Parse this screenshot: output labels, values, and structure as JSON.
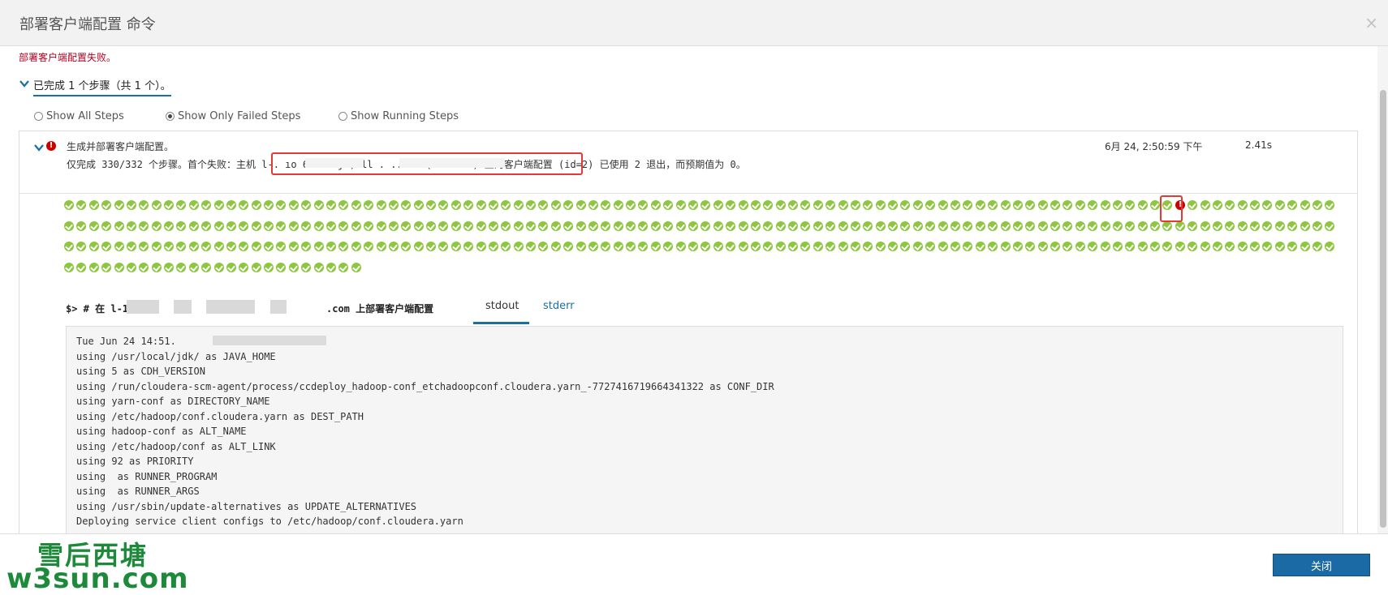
{
  "header": {
    "title": "部署客户端配置 命令",
    "close_glyph": "×"
  },
  "status": {
    "failure_message": "部署客户端配置失败。"
  },
  "summary": {
    "label": "已完成 1 个步骤（共 1 个）。"
  },
  "filters": [
    {
      "label": "Show All Steps",
      "checked": false
    },
    {
      "label": "Show Only Failed Steps",
      "checked": true
    },
    {
      "label": "Show Running Steps",
      "checked": false
    }
  ],
  "step": {
    "title": "生成并部署客户端配置。",
    "timestamp": "6月 24, 2:50:59 下午",
    "duration": "2.41s",
    "detail": "仅完成 330/332 个步骤。首个失败：主机 l-.          ıo 6d5    ı  j  , ll     .    ..com (id=8335) 上的客户端配置 (id=2) 已使用 2 退出，而预期值为 0。"
  },
  "command": {
    "prefix": "$> # 在 l-1",
    "suffix": ".com 上部署客户端配置",
    "tabs": [
      "stdout",
      "stderr"
    ],
    "active_tab": "stdout"
  },
  "output_lines": [
    "Tue Jun 24 14:51.",
    "using /usr/local/jdk/ as JAVA_HOME",
    "using 5 as CDH_VERSION",
    "using /run/cloudera-scm-agent/process/ccdeploy_hadoop-conf_etchadoopconf.cloudera.yarn_-7727416719664341322 as CONF_DIR",
    "using yarn-conf as DIRECTORY_NAME",
    "using /etc/hadoop/conf.cloudera.yarn as DEST_PATH",
    "using hadoop-conf as ALT_NAME",
    "using /etc/hadoop/conf as ALT_LINK",
    "using 92 as PRIORITY",
    "using  as RUNNER_PROGRAM",
    "using  as RUNNER_ARGS",
    "using /usr/sbin/update-alternatives as UPDATE_ALTERNATIVES",
    "Deploying service client configs to /etc/hadoop/conf.cloudera.yarn"
  ],
  "footer": {
    "close_label": "关闭"
  },
  "watermark": {
    "cn": "雪后西塘",
    "en": "w3sun.com"
  },
  "colors": {
    "accent": "#1b6aa5",
    "success": "#8dc63f",
    "error": "#cc0000",
    "highlight_box": "#e53935"
  },
  "step_grid": {
    "rows": [
      102,
      102,
      102,
      24
    ],
    "failed_index": 89
  }
}
